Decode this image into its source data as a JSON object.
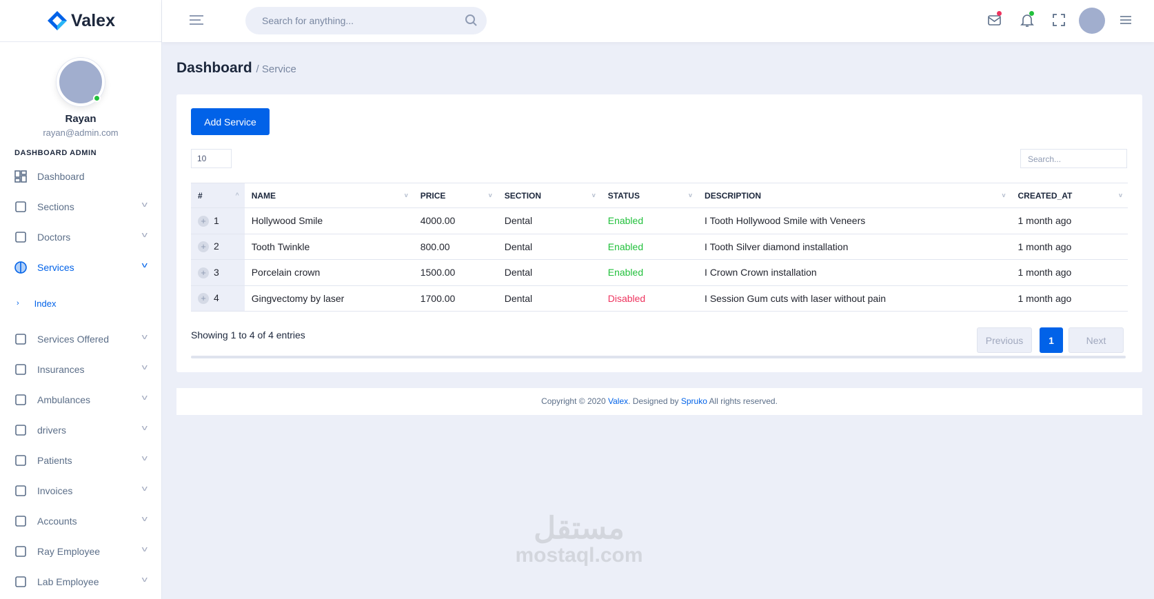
{
  "brand": {
    "name": "Valex",
    "colors": {
      "primary": "#0162e8",
      "success": "#22c03c",
      "danger": "#ee335e"
    }
  },
  "user": {
    "name": "Rayan",
    "email": "rayan@admin.com",
    "status": "online"
  },
  "sidebar": {
    "section_label": "DASHBOARD ADMIN",
    "items": [
      {
        "label": "Dashboard",
        "icon": "dashboard-grid-icon"
      },
      {
        "label": "Sections",
        "icon": "bar-chart-icon"
      },
      {
        "label": "Doctors",
        "icon": "basket-icon"
      },
      {
        "label": "Services",
        "icon": "pie-icon",
        "active": true,
        "sub": [
          {
            "label": "Index"
          }
        ]
      },
      {
        "label": "Services Offered",
        "icon": "layers-icon"
      },
      {
        "label": "Insurances",
        "icon": "palette-icon"
      },
      {
        "label": "Ambulances",
        "icon": "chat-icon"
      },
      {
        "label": "drivers",
        "icon": "document-icon"
      },
      {
        "label": "Patients",
        "icon": "table-icon"
      },
      {
        "label": "Invoices",
        "icon": "location-pin-icon"
      },
      {
        "label": "Accounts",
        "icon": "book-icon"
      },
      {
        "label": "Ray Employee",
        "icon": "aperture-icon"
      },
      {
        "label": "Lab Employee",
        "icon": "lock-icon"
      }
    ]
  },
  "topbar": {
    "search_placeholder": "Search for anything..."
  },
  "page": {
    "title": "Dashboard",
    "breadcrumb": "/ Service"
  },
  "card": {
    "add_button": "Add Service",
    "page_length": "10",
    "search_placeholder": "Search...",
    "columns": [
      "#",
      "NAME",
      "PRICE",
      "SECTION",
      "STATUS",
      "DESCRIPTION",
      "CREATED_AT"
    ],
    "rows": [
      {
        "id": "1",
        "name": "Hollywood Smile",
        "price": "4000.00",
        "section": "Dental",
        "status": "Enabled",
        "description": "I Tooth Hollywood Smile with Veneers",
        "created": "1 month ago"
      },
      {
        "id": "2",
        "name": "Tooth Twinkle",
        "price": "800.00",
        "section": "Dental",
        "status": "Enabled",
        "description": "I Tooth Silver diamond installation",
        "created": "1 month ago"
      },
      {
        "id": "3",
        "name": "Porcelain crown",
        "price": "1500.00",
        "section": "Dental",
        "status": "Enabled",
        "description": "I Crown Crown installation",
        "created": "1 month ago"
      },
      {
        "id": "4",
        "name": "Gingvectomy by laser",
        "price": "1700.00",
        "section": "Dental",
        "status": "Disabled",
        "description": "I Session Gum cuts with laser without pain",
        "created": "1 month ago"
      }
    ],
    "info": "Showing 1 to 4 of 4 entries",
    "pagination": {
      "previous": "Previous",
      "current": "1",
      "next": "Next"
    }
  },
  "footer": {
    "prefix": "Copyright © 2020 ",
    "brand": "Valex",
    "mid": ". Designed by ",
    "designer": "Spruko",
    "suffix": " All rights reserved."
  },
  "watermark": {
    "arabic": "مستقل",
    "latin": "mostaql.com"
  }
}
